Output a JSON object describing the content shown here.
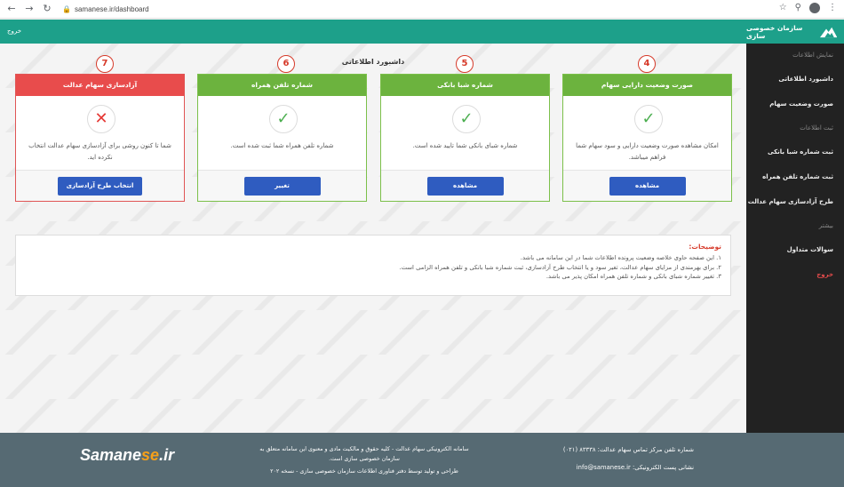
{
  "browser": {
    "url": "samanese.ir/dashboard"
  },
  "header": {
    "logout": "خروج",
    "brand": "سازمان خصوصی سازی"
  },
  "sidebar": {
    "section1": "نمایش اطلاعات",
    "item_dashboard": "داشبورد اطلاعاتی",
    "item_assets": "صورت وضعیت سهام",
    "section2": "ثبت اطلاعات",
    "item_shaba": "ثبت شماره شبا بانکی",
    "item_phone": "ثبت شماره تلفن همراه",
    "item_freeing": "طرح آزادسازی سهام عدالت",
    "section3": "بیشتر",
    "item_faq": "سوالات متداول",
    "item_exit": "خروج"
  },
  "main": {
    "title": "داشبورد اطلاعاتی",
    "steps": [
      "4",
      "5",
      "6",
      "7"
    ],
    "cards": [
      {
        "title": "صورت وضعیت دارایی سهام",
        "text": "امکان مشاهده صورت وضعیت دارایی و سود سهام شما فراهم میباشد.",
        "button": "مشاهده",
        "status": "ok"
      },
      {
        "title": "شماره شبا بانکی",
        "text": "شماره شبای بانکی شما تایید شده است.",
        "button": "مشاهده",
        "status": "ok"
      },
      {
        "title": "شماره تلفن همراه",
        "text": "شماره تلفن همراه شما ثبت شده است.",
        "button": "تغییر",
        "status": "ok"
      },
      {
        "title": "آزادسازی سهام عدالت",
        "text": "شما تا کنون روشی برای آزادسازی سهام عدالت انتخاب نکرده اید.",
        "button": "انتخاب طرح آزادسازی",
        "status": "no"
      }
    ],
    "notes": {
      "title": "توضیحات:",
      "lines": [
        "۱. این صفحه حاوی خلاصه وضعیت پرونده اطلاعات شما در این سامانه می باشد.",
        "۲. برای بهرمندی از مزایای سهام عدالت، تغیر سود و یا انتخاب طرح آزادسازی، ثبت شماره شبا بانکی و تلفن همراه الزامی است.",
        "۳. تغییر شماره شبای بانکی و شماره تلفن همراه امکان پذیر می باشد."
      ]
    }
  },
  "footer": {
    "logo_main": "Samane",
    "logo_accent": "se",
    "logo_suffix": ".ir",
    "mid_line1": "سامانه الکترونیکی سهام عدالت - کلیه حقوق و مالکیت مادی و معنوی این سامانه متعلق به",
    "mid_line2": "سازمان خصوصی سازی است.",
    "mid_line3": "طراحی و تولید توسط دفتر فناوری اطلاعات سازمان خصوصی سازی - نسخه ۲۰۲",
    "phone": "شماره تلفن مرکز تماس سهام عدالت: ۸۳۳۳۸ (۰۲۱)",
    "email": "نشانی پست الکترونیکی: info@samanese.ir"
  },
  "colors": {
    "header": "#1da08a",
    "card_green": "#6cb33e",
    "card_red": "#e84c4c",
    "button": "#2f5cc0",
    "footer": "#566a73",
    "sidebar": "#222222"
  }
}
